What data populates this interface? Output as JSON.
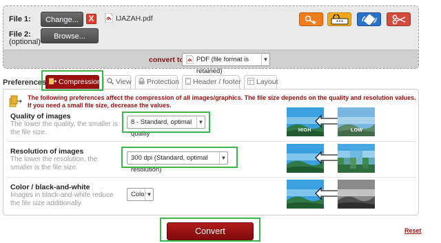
{
  "files": {
    "file1_label": "File 1:",
    "file2_label": "File 2:",
    "file2_sublabel": "(optional)",
    "change_button": "Change...",
    "remove_button": "X",
    "browse_button": "Browse...",
    "file1_name": "IJAZAH.pdf"
  },
  "tools": [
    {
      "icon": "keys-icon",
      "color": "#f07c1e"
    },
    {
      "icon": "password-icon",
      "color": "#f0a818"
    },
    {
      "icon": "rotate-icon",
      "color": "#2a71c8"
    },
    {
      "icon": "scissors-icon",
      "color": "#d44a3c"
    }
  ],
  "convert": {
    "label": "convert to:",
    "format_value": "PDF (file format is retained)"
  },
  "preferences": {
    "label": "Preferences:",
    "tabs": [
      {
        "label": "Compression",
        "icon": "compression-icon",
        "active": true
      },
      {
        "label": "View",
        "icon": "magnifier-icon",
        "active": false
      },
      {
        "label": "Protection",
        "icon": "lock-icon",
        "active": false
      },
      {
        "label": "Header / footer",
        "icon": "page-icon",
        "active": false
      },
      {
        "label": "Layout",
        "icon": "layout-icon",
        "active": false
      }
    ]
  },
  "compression": {
    "info_line1": "The following preferences affect the compression of all images/graphics. The file size depends on the quality and resolution values.",
    "info_line2": "If you need a small file size, decrease the values.",
    "quality": {
      "title": "Quality of images",
      "desc": "The lower the quality, the smaller is the file size.",
      "value": "8 - Standard, optimal quality",
      "left_tag": "HIGH",
      "right_tag": "LOW"
    },
    "resolution": {
      "title": "Resolution of images",
      "desc": "The lower the resolution, the smaller is the file size.",
      "value": "300 dpi (Standard, optimal resolution)"
    },
    "color": {
      "title": "Color / black-and-white",
      "desc": "Images in black-and-white reduce the file size additionally",
      "value": "Color"
    }
  },
  "actions": {
    "convert_button": "Convert",
    "reset_link": "Reset"
  },
  "colors": {
    "accent_red": "#9a1010",
    "highlight_green": "#3cb64a"
  }
}
